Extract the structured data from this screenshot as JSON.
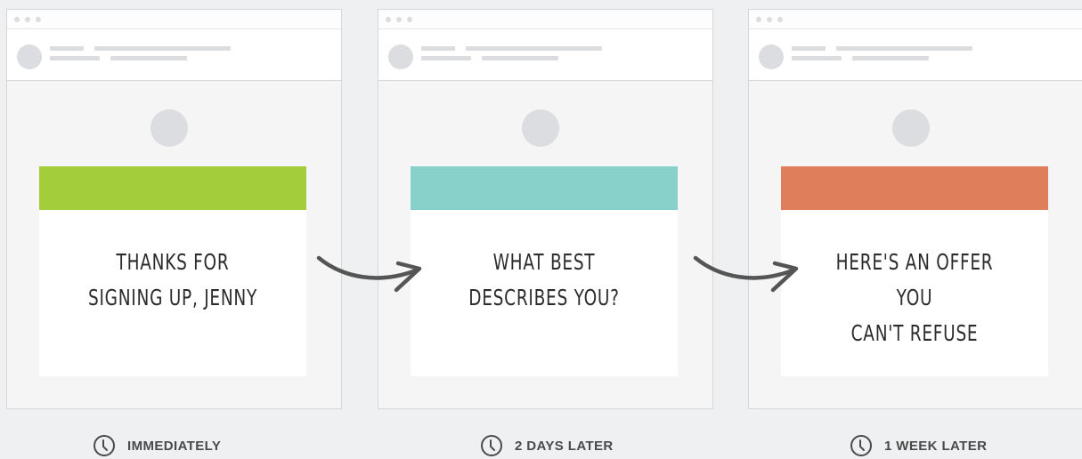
{
  "steps": [
    {
      "message": "THANKS FOR\nSIGNING UP, JENNY",
      "accent_color": "#a3cd3b",
      "timing": "IMMEDIATELY",
      "icon": "clock-icon"
    },
    {
      "message": "WHAT BEST\nDESCRIBES YOU?",
      "accent_color": "#87d1ca",
      "timing": "2 DAYS LATER",
      "icon": "clock-icon"
    },
    {
      "message": "HERE'S AN OFFER YOU\nCAN'T REFUSE",
      "accent_color": "#df7e5a",
      "timing": "1 WEEK LATER",
      "icon": "clock-icon"
    }
  ],
  "colors": {
    "background": "#eff0f1",
    "window_body": "#f5f5f5",
    "placeholder": "#dcdde0",
    "arrow": "#555555",
    "text": "#2c2c2c"
  }
}
